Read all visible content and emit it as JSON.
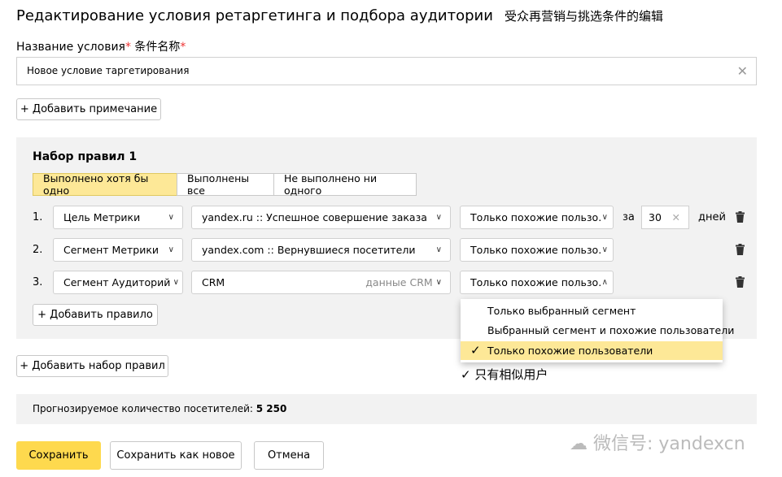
{
  "title": "Редактирование условия ретаргетинга и подбора аудитории",
  "title_zh": "受众再营销与挑选条件的编辑",
  "name_label": "Название условия",
  "name_label_zh": "条件名称",
  "required_mark": "*",
  "name_value": "Новое условие таргетирования",
  "add_note": "+ Добавить примечание",
  "ruleset": {
    "title": "Набор правил 1",
    "tabs": [
      "Выполнено хотя бы одно",
      "Выполнены все",
      "Не выполнено ни одного"
    ],
    "rows": [
      {
        "num": "1.",
        "type": "Цель Метрики",
        "target": "yandex.ru :: Успешное совершение заказа",
        "hint": "",
        "mode": "Только похожие пользо...",
        "for": "за",
        "days": "30",
        "days_label": "дней"
      },
      {
        "num": "2.",
        "type": "Сегмент Метрики",
        "target": "yandex.com :: Вернувшиеся посетители",
        "hint": "",
        "mode": "Только похожие пользо..."
      },
      {
        "num": "3.",
        "type": "Сегмент Аудиторий",
        "target": "CRM",
        "hint": "данные CRM",
        "mode": "Только похожие пользо..."
      }
    ],
    "add_rule": "+ Добавить правило"
  },
  "dropdown": {
    "options": [
      "Только выбранный сегмент",
      "Выбранный сегмент и похожие пользователи",
      "Только похожие пользователи"
    ],
    "check": "✓"
  },
  "annotation_zh": "✓ 只有相似用户",
  "add_ruleset": "+ Добавить набор правил",
  "forecast_label": "Прогнозируемое количество посетителей:",
  "forecast_value": "5 250",
  "buttons": {
    "save": "Сохранить",
    "save_new": "Сохранить как новое",
    "cancel": "Отмена"
  },
  "watermark": "微信号: yandexcn"
}
